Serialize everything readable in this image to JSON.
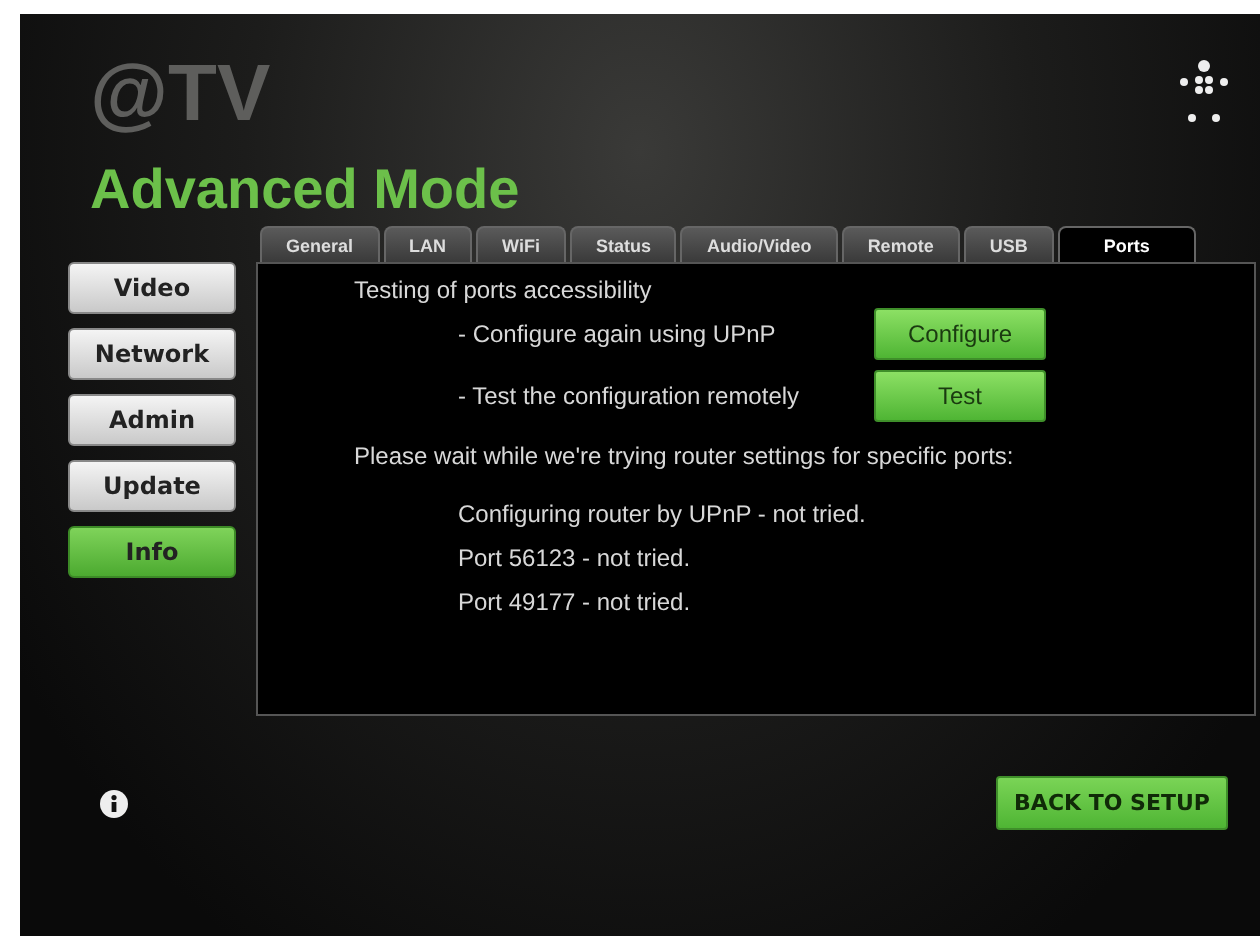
{
  "brand": "@TV",
  "title": "Advanced Mode",
  "sidebar": {
    "items": [
      {
        "label": "Video",
        "selected": false
      },
      {
        "label": "Network",
        "selected": false
      },
      {
        "label": "Admin",
        "selected": false
      },
      {
        "label": "Update",
        "selected": false
      },
      {
        "label": "Info",
        "selected": true
      }
    ]
  },
  "tabs": [
    {
      "label": "General",
      "selected": false
    },
    {
      "label": "LAN",
      "selected": false
    },
    {
      "label": "WiFi",
      "selected": false
    },
    {
      "label": "Status",
      "selected": false
    },
    {
      "label": "Audio/Video",
      "selected": false
    },
    {
      "label": "Remote",
      "selected": false
    },
    {
      "label": "USB",
      "selected": false
    },
    {
      "label": "Ports",
      "selected": true
    }
  ],
  "panel": {
    "heading": "Testing of ports accessibility",
    "actions": [
      {
        "text": "- Configure again using UPnP",
        "button": "Configure"
      },
      {
        "text": "- Test the configuration remotely",
        "button": "Test"
      }
    ],
    "wait_message": "Please wait while we're trying router settings for specific ports:",
    "results": [
      "Configuring router by UPnP - not tried.",
      "Port 56123 - not tried.",
      "Port 49177 - not tried."
    ]
  },
  "back_button": "BACK TO SETUP"
}
